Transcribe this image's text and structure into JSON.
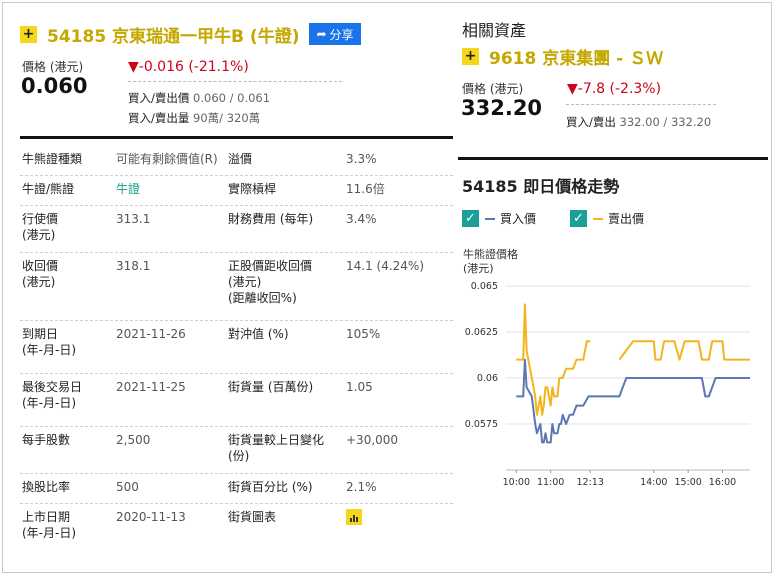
{
  "stock": {
    "plus": "+",
    "title": "54185  京東瑞通一甲牛B (牛證)",
    "share_label": "分享",
    "price_label": "價格 (港元)",
    "price": "0.060",
    "change": "▼-0.016 (-21.1%)",
    "bidask_price_label": "買入/賣出價",
    "bidask_price": "0.060 / 0.061",
    "bidask_vol_label": "買入/賣出量",
    "bidask_vol": "90萬/ 320萬"
  },
  "details": {
    "rows": [
      {
        "k1": "牛熊證種類",
        "v1": "可能有剩餘價值(R)",
        "k2": "溢價",
        "v2": "3.3%"
      },
      {
        "k1": "牛證/熊證",
        "v1": "牛證",
        "k2": "實際槓桿",
        "v2": "11.6倍"
      },
      {
        "k1": "行使價\n(港元)",
        "v1": "313.1",
        "k2": "財務費用 (每年)",
        "v2": "3.4%"
      },
      {
        "k1": "收回價\n(港元)",
        "v1": "318.1",
        "k2": "正股價距收回價\n(港元)\n(距離收回%)",
        "v2": "14.1 (4.24%)"
      },
      {
        "k1": "到期日\n(年-月-日)",
        "v1": "2021-11-26",
        "k2": "對沖值 (%)",
        "v2": "105%"
      },
      {
        "k1": "最後交易日\n(年-月-日)",
        "v1": "2021-11-25",
        "k2": "街貨量 (百萬份)",
        "v2": "1.05"
      },
      {
        "k1": "每手股數",
        "v1": "2,500",
        "k2": "街貨量較上日變化\n(份)",
        "v2": "+30,000"
      },
      {
        "k1": "換股比率",
        "v1": "500",
        "k2": "街貨百分比 (%)",
        "v2": "2.1%"
      },
      {
        "k1": "上市日期\n(年-月-日)",
        "v1": "2020-11-13",
        "k2": "街貨圖表",
        "v2": ""
      }
    ]
  },
  "related": {
    "title": "相關資產",
    "plus": "+",
    "name": "9618  京東集團 - ＳＷ",
    "price_label": "價格 (港元)",
    "price": "332.20",
    "change": "▼-7.8 (-2.3%)",
    "bidask_label": "買入/賣出",
    "bidask": "332.00 / 332.20"
  },
  "intraday": {
    "title": "54185 即日價格走勢",
    "legend_bid": "買入價",
    "legend_ask": "賣出價",
    "ylabel": "牛熊證價格\n(港元)"
  },
  "colors": {
    "accent_yellow": "#f4d71c",
    "down_red": "#d0021b",
    "teal": "#1aa098",
    "bid_line": "#5b78b4",
    "ask_line": "#f5b31c",
    "share_blue": "#1a73e8"
  },
  "chart_data": {
    "type": "line",
    "title": "",
    "xlabel": "",
    "ylabel": "牛熊證價格 (港元)",
    "ylim": [
      0.055,
      0.065
    ],
    "yticks": [
      "0.065",
      "0.0625",
      "0.06",
      "0.0575"
    ],
    "xlim": [
      9.7,
      16.8
    ],
    "xticks": [
      "10:00",
      "11:00",
      "12:13",
      "14:00",
      "15:00",
      "16:00"
    ],
    "xtick_values": [
      10.0,
      11.0,
      12.15,
      14.0,
      15.0,
      16.0
    ],
    "grid": "horizontal",
    "series": [
      {
        "name": "買入價",
        "color": "#5b78b4",
        "x": [
          10.0,
          10.2,
          10.25,
          10.3,
          10.45,
          10.55,
          10.6,
          10.7,
          10.75,
          10.8,
          10.85,
          10.9,
          11.0,
          11.05,
          11.1,
          11.2,
          11.25,
          11.3,
          11.35,
          11.45,
          11.55,
          11.65,
          11.75,
          11.95,
          12.1,
          12.15,
          13.0,
          13.1,
          13.2,
          13.4,
          13.5,
          15.4,
          15.5,
          15.6,
          15.8,
          16.8
        ],
        "y": [
          0.059,
          0.059,
          0.061,
          0.0595,
          0.059,
          0.0575,
          0.057,
          0.0575,
          0.0565,
          0.0565,
          0.057,
          0.0565,
          0.0565,
          0.0575,
          0.057,
          0.057,
          0.0575,
          0.0575,
          0.058,
          0.0575,
          0.058,
          0.058,
          0.0585,
          0.0585,
          0.059,
          0.059,
          0.059,
          0.0595,
          0.06,
          0.06,
          0.06,
          0.06,
          0.059,
          0.059,
          0.06,
          0.06
        ]
      },
      {
        "name": "賣出價",
        "color": "#f5b31c",
        "x": [
          10.0,
          10.2,
          10.25,
          10.3,
          10.45,
          10.55,
          10.6,
          10.7,
          10.75,
          10.8,
          10.85,
          10.9,
          11.0,
          11.05,
          11.1,
          11.2,
          11.25,
          11.3,
          11.35,
          11.45,
          11.55,
          11.65,
          11.75,
          11.95,
          12.05,
          12.15
        ],
        "y": [
          0.061,
          0.061,
          0.064,
          0.0615,
          0.06,
          0.059,
          0.058,
          0.059,
          0.058,
          0.0585,
          0.0595,
          0.0595,
          0.0585,
          0.0595,
          0.059,
          0.059,
          0.06,
          0.06,
          0.06,
          0.0605,
          0.0605,
          0.0605,
          0.061,
          0.061,
          0.062,
          0.062
        ]
      },
      {
        "name": "賣出價",
        "color": "#f5b31c",
        "x": [
          13.0,
          13.2,
          13.4,
          13.5,
          14.0,
          14.05,
          14.2,
          14.3,
          14.6,
          14.75,
          14.9,
          15.3,
          15.4,
          15.5,
          15.6,
          15.7,
          16.0,
          16.05,
          16.15,
          16.8
        ],
        "y": [
          0.061,
          0.0615,
          0.062,
          0.062,
          0.062,
          0.061,
          0.061,
          0.062,
          0.062,
          0.061,
          0.062,
          0.062,
          0.061,
          0.061,
          0.061,
          0.062,
          0.062,
          0.061,
          0.061,
          0.061
        ]
      }
    ]
  }
}
